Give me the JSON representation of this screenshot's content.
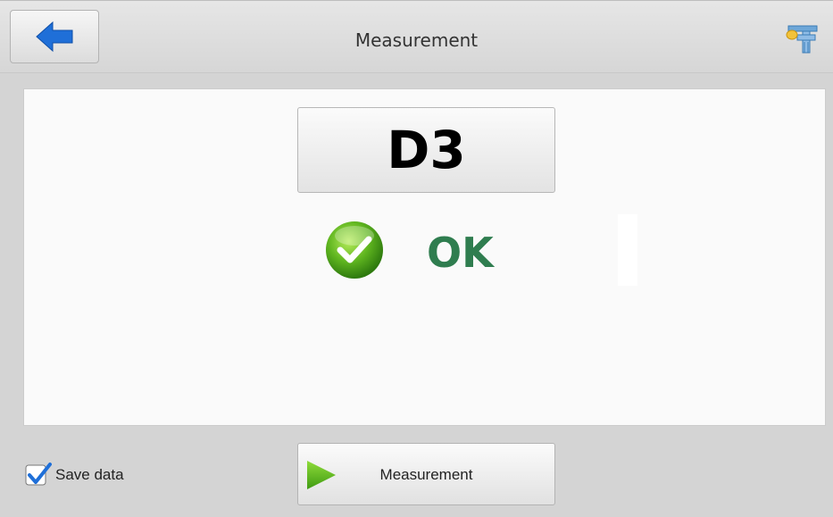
{
  "header": {
    "title": "Measurement",
    "back_icon": "back-arrow-icon",
    "tool_icon": "caliper-icon"
  },
  "result": {
    "code": "D3",
    "status": "OK",
    "status_icon": "check-circle-icon",
    "status_color": "#2f7d4f"
  },
  "footer": {
    "save_data_label": "Save data",
    "save_data_checked": true,
    "measure_button_label": "Measurement",
    "measure_button_icon": "play-icon"
  },
  "colors": {
    "accent_blue": "#1f6fd8",
    "ok_green": "#2f7d4f",
    "play_green": "#4caf1f"
  }
}
